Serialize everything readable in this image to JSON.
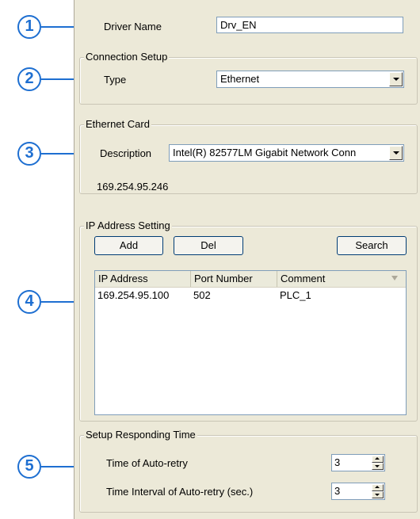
{
  "callouts": [
    "1",
    "2",
    "3",
    "4",
    "5"
  ],
  "driver": {
    "label": "Driver Name",
    "value": "Drv_EN"
  },
  "connection": {
    "legend": "Connection Setup",
    "type_label": "Type",
    "type_value": "Ethernet"
  },
  "ethernet_card": {
    "legend": "Ethernet Card",
    "description_label": "Description",
    "description_value": "Intel(R) 82577LM Gigabit Network Conn",
    "ip": "169.254.95.246"
  },
  "ip_setting": {
    "legend": "IP Address Setting",
    "add_label": "Add",
    "del_label": "Del",
    "search_label": "Search",
    "columns": [
      "IP Address",
      "Port Number",
      "Comment"
    ],
    "sort_icon": "sort-triangle-icon",
    "rows": [
      {
        "ip": "169.254.95.100",
        "port": "502",
        "comment": "PLC_1"
      }
    ]
  },
  "responding": {
    "legend": "Setup Responding Time",
    "retry_label": "Time of Auto-retry",
    "retry_value": "3",
    "interval_label": "Time Interval of Auto-retry (sec.)",
    "interval_value": "3"
  },
  "colors": {
    "accent": "#1e6fd1",
    "panel": "#ece9d8",
    "field_border": "#7f9db9"
  }
}
